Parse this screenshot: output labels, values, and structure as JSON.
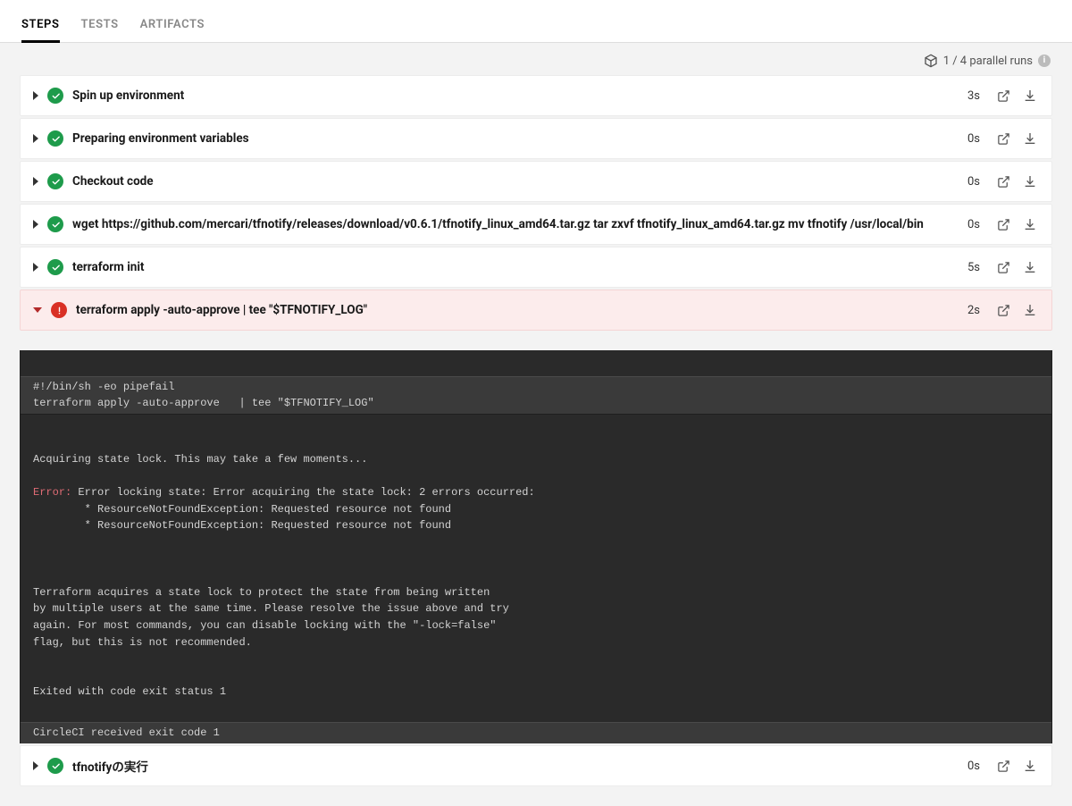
{
  "tabs": {
    "steps": "STEPS",
    "tests": "TESTS",
    "artifacts": "ARTIFACTS"
  },
  "parallel_runs": "1 / 4 parallel runs",
  "steps": [
    {
      "title": "Spin up environment",
      "status": "success",
      "duration": "3s",
      "expanded": false
    },
    {
      "title": "Preparing environment variables",
      "status": "success",
      "duration": "0s",
      "expanded": false
    },
    {
      "title": "Checkout code",
      "status": "success",
      "duration": "0s",
      "expanded": false
    },
    {
      "title": "wget https://github.com/mercari/tfnotify/releases/download/v0.6.1/tfnotify_linux_amd64.tar.gz tar zxvf tfnotify_linux_amd64.tar.gz mv tfnotify /usr/local/bin",
      "status": "success",
      "duration": "0s",
      "expanded": false
    },
    {
      "title": "terraform init",
      "status": "success",
      "duration": "5s",
      "expanded": false
    },
    {
      "title": "terraform apply -auto-approve | tee \"$TFNOTIFY_LOG\"",
      "status": "fail",
      "duration": "2s",
      "expanded": true
    },
    {
      "title": "tfnotifyの実行",
      "status": "success",
      "duration": "0s",
      "expanded": false
    }
  ],
  "log": {
    "header_l1": "#!/bin/sh -eo pipefail",
    "header_l2": "terraform apply -auto-approve   | tee \"$TFNOTIFY_LOG\"",
    "acquiring": "Acquiring state lock. This may take a few moments...",
    "error_prefix": "Error:",
    "error_rest": " Error locking state: Error acquiring the state lock: 2 errors occurred:",
    "err_l2": "        * ResourceNotFoundException: Requested resource not found",
    "err_l3": "        * ResourceNotFoundException: Requested resource not found",
    "expl_l1": "Terraform acquires a state lock to protect the state from being written",
    "expl_l2": "by multiple users at the same time. Please resolve the issue above and try",
    "expl_l3": "again. For most commands, you can disable locking with the \"-lock=false\"",
    "expl_l4": "flag, but this is not recommended.",
    "exit_code": "Exited with code exit status 1",
    "footer": "CircleCI received exit code 1"
  }
}
